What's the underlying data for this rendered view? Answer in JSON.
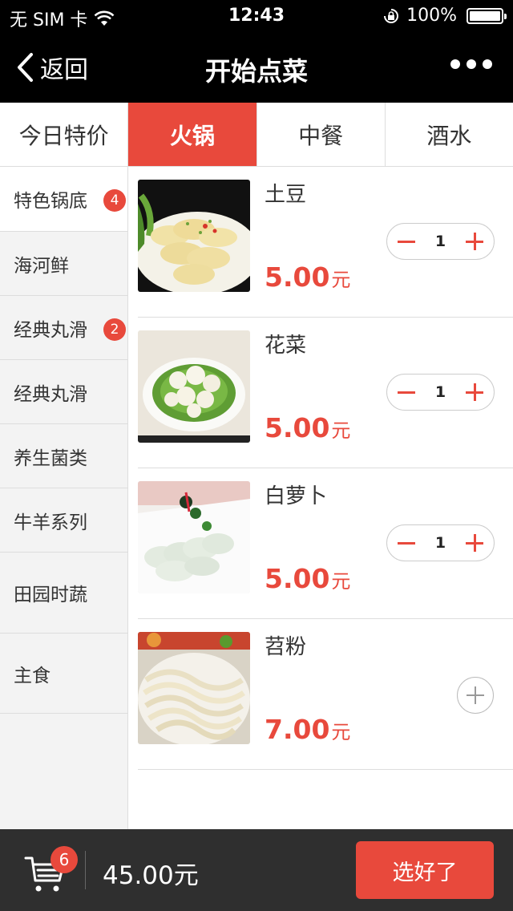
{
  "status_bar": {
    "carrier": "无 SIM 卡",
    "time": "12:43",
    "battery": "100%",
    "battery_level": 1.0
  },
  "nav": {
    "back_label": "返回",
    "title": "开始点菜"
  },
  "tabs": [
    {
      "label": "今日特价",
      "active": false
    },
    {
      "label": "火锅",
      "active": true
    },
    {
      "label": "中餐",
      "active": false
    },
    {
      "label": "酒水",
      "active": false
    }
  ],
  "sidebar": {
    "items": [
      {
        "label": "特色锅底",
        "badge": "4",
        "active": true
      },
      {
        "label": "海河鲜",
        "badge": ""
      },
      {
        "label": "经典丸滑",
        "badge": "2"
      },
      {
        "label": "经典丸滑",
        "badge": ""
      },
      {
        "label": "养生菌类",
        "badge": ""
      },
      {
        "label": "牛羊系列",
        "badge": ""
      },
      {
        "label": "田园时蔬",
        "badge": ""
      },
      {
        "label": "主食",
        "badge": ""
      }
    ]
  },
  "dishes": [
    {
      "name": "土豆",
      "price": "5.00",
      "unit": "元",
      "qty": "1"
    },
    {
      "name": "花菜",
      "price": "5.00",
      "unit": "元",
      "qty": "1"
    },
    {
      "name": "白萝卜",
      "price": "5.00",
      "unit": "元",
      "qty": "1"
    },
    {
      "name": "苕粉",
      "price": "7.00",
      "unit": "元",
      "qty": ""
    }
  ],
  "cart": {
    "count": "6",
    "total": "45.00元",
    "checkout_label": "选好了"
  },
  "colors": {
    "accent": "#e8493c",
    "bar": "#000000",
    "bottom": "#2f2f2f"
  }
}
